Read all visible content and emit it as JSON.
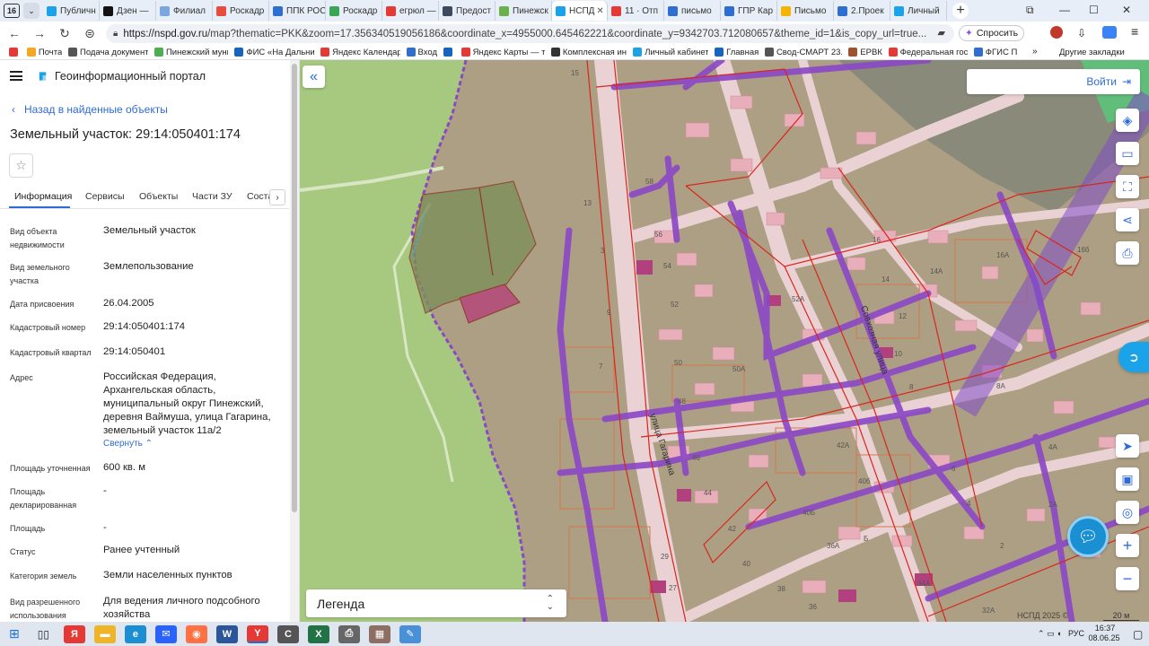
{
  "browser": {
    "tab_count": "16",
    "tabs": [
      {
        "label": "Публичн",
        "color": "#1aa3e8"
      },
      {
        "label": "Дзен —",
        "color": "#111111"
      },
      {
        "label": "Филиал",
        "color": "#7aa7e0"
      },
      {
        "label": "Роскадр",
        "color": "#e84c3d"
      },
      {
        "label": "ППК РОС",
        "color": "#2d6ed0"
      },
      {
        "label": "Роскадр",
        "color": "#3aa655"
      },
      {
        "label": "егрюл —",
        "color": "#e53935"
      },
      {
        "label": "Предост",
        "color": "#3b4a5c"
      },
      {
        "label": "Пинежск",
        "color": "#6ab04c"
      },
      {
        "label": "НСПД",
        "color": "#1aa3e8",
        "active": true
      },
      {
        "label": "11 · Отп",
        "color": "#e53935"
      },
      {
        "label": "письмо",
        "color": "#2d6ed0"
      },
      {
        "label": "ГПР Кар",
        "color": "#2d6ed0"
      },
      {
        "label": "Письмо",
        "color": "#f5b400"
      },
      {
        "label": "2.Проек",
        "color": "#2d6ed0"
      },
      {
        "label": "Личный",
        "color": "#1aa3e8"
      }
    ],
    "url_host": "https://nspd.gov.ru",
    "url_rest": "/map?thematic=PKK&zoom=17.356340519056186&coordinate_x=4955000.645462221&coordinate_y=9342703.712080657&theme_id=1&is_copy_url=true...",
    "ask_label": "Спросить",
    "bookmarks": [
      {
        "label": "",
        "color": "#e53935"
      },
      {
        "label": "Почта",
        "color": "#f5a623"
      },
      {
        "label": "Подача документ",
        "color": "#555555"
      },
      {
        "label": "Пинежский муни",
        "color": "#4caf50"
      },
      {
        "label": "ФИС «На Дальни",
        "color": "#1565c0"
      },
      {
        "label": "Яндекс Календар",
        "color": "#e53935"
      },
      {
        "label": "Вход",
        "color": "#2d6ed0"
      },
      {
        "label": "",
        "color": "#1565c0"
      },
      {
        "label": "Яндекс Карты — т",
        "color": "#e53935"
      },
      {
        "label": "Комплексная инф",
        "color": "#333333"
      },
      {
        "label": "Личный кабинет",
        "color": "#1aa3e8"
      },
      {
        "label": "Главная",
        "color": "#1565c0"
      },
      {
        "label": "Свод-СМАРТ 23.1",
        "color": "#555555"
      },
      {
        "label": "ЕРВК",
        "color": "#a0522d"
      },
      {
        "label": "Федеральная гос",
        "color": "#e53935"
      },
      {
        "label": "ФГИС П",
        "color": "#2d6ed0"
      }
    ],
    "bookmarks_more": "»",
    "all_bookmarks": "Другие закладки"
  },
  "sidebar": {
    "portal_title": "Геоинформационный портал",
    "back_link": "Назад в найденные объекты",
    "object_title": "Земельный участок: 29:14:050401:174",
    "tabs": [
      "Информация",
      "Сервисы",
      "Объекты",
      "Части ЗУ",
      "Соста"
    ],
    "properties": [
      {
        "label": "Вид объекта недвижимости",
        "value": "Земельный участок"
      },
      {
        "label": "Вид земельного участка",
        "value": "Землепользование"
      },
      {
        "label": "Дата присвоения",
        "value": "26.04.2005"
      },
      {
        "label": "Кадастровый номер",
        "value": "29:14:050401:174"
      },
      {
        "label": "Кадастровый квартал",
        "value": "29:14:050401"
      },
      {
        "label": "Адрес",
        "value": "Российская Федерация, Архангельская область, муниципальный округ Пинежский, деревня Ваймуша, улица Гагарина, земельный участок 11а/2"
      },
      {
        "label": "Площадь уточненная",
        "value": "600 кв. м"
      },
      {
        "label": "Площадь декларированная",
        "value": "-"
      },
      {
        "label": "Площадь",
        "value": "-"
      },
      {
        "label": "Статус",
        "value": "Ранее учтенный"
      },
      {
        "label": "Категория земель",
        "value": "Земли населенных пунктов"
      },
      {
        "label": "Вид разрешенного использования",
        "value": "Для ведения личного подсобного хозяйства"
      }
    ],
    "collapse_link": "Свернуть"
  },
  "map": {
    "login_label": "Войти",
    "legend_label": "Легенда",
    "copyright": "НСПД 2025 ©",
    "scale": "20 м",
    "streets": [
      "улица Гагарина",
      "Совхозная улица"
    ],
    "parcel_numbers": [
      "15",
      "58",
      "56",
      "54",
      "52",
      "50",
      "50А",
      "48",
      "46",
      "44",
      "42",
      "40",
      "38",
      "36",
      "36А",
      "40Б",
      "40б",
      "42А",
      "16",
      "14",
      "14А",
      "12",
      "10",
      "8",
      "8А",
      "6",
      "4",
      "4А",
      "2",
      "2А",
      "16б",
      "16А",
      "7",
      "9",
      "3",
      "13",
      "52А",
      "27",
      "29",
      "34А",
      "32А",
      "Б"
    ],
    "colors": {
      "ground": "#ad9f84",
      "green": "#a7c97f",
      "road": "#ead2d4",
      "purple": "#8b47c6",
      "red": "#d9261c",
      "accent": "#2f6bd6"
    }
  },
  "taskbar": {
    "language": "РУС",
    "time": "16:37",
    "date": "08.06.25"
  }
}
